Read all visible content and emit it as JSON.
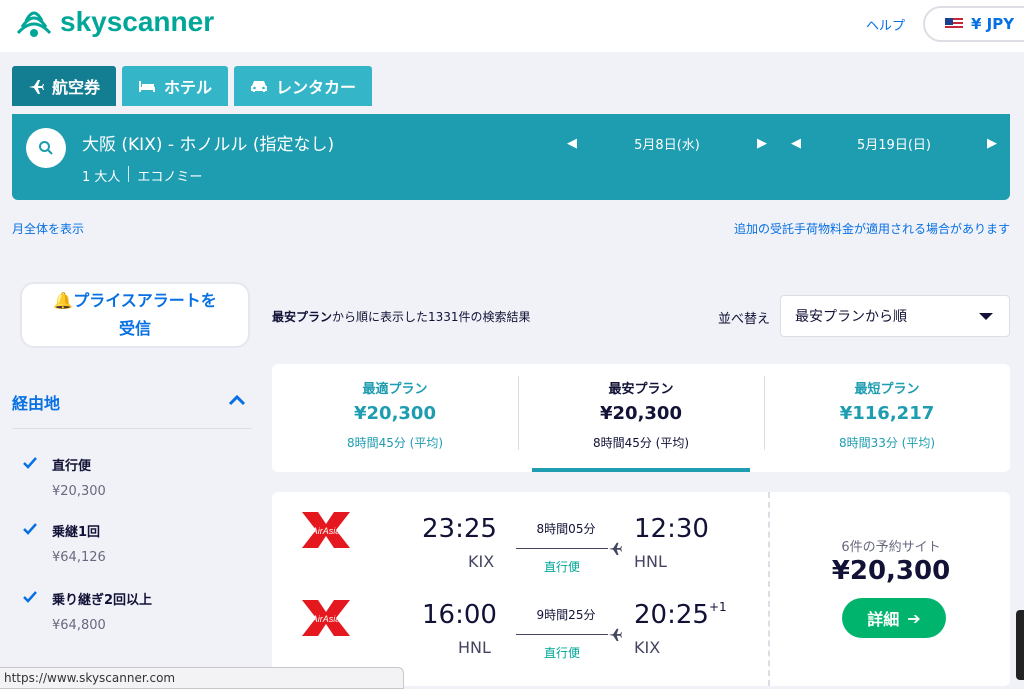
{
  "header": {
    "logo_text": "skyscanner",
    "help": "ヘルプ",
    "currency": "¥ JPY"
  },
  "tabs": [
    {
      "label": "航空券",
      "icon": "plane-icon"
    },
    {
      "label": "ホテル",
      "icon": "bed-icon"
    },
    {
      "label": "レンタカー",
      "icon": "car-icon"
    }
  ],
  "search": {
    "route": "大阪 (KIX) - ホノルル (指定なし)",
    "passengers": "1 大人",
    "cabin": "エコノミー",
    "depart_date": "5月8日(水)",
    "return_date": "5月19日(日)"
  },
  "links": {
    "month_view": "月全体を表示",
    "baggage_note": "追加の受託手荷物料金が適用される場合があります"
  },
  "sidebar": {
    "price_alert_line1": "プライスアラートを",
    "price_alert_line2": "受信",
    "stops_title": "経由地",
    "filters": [
      {
        "name": "直行便",
        "price": "¥20,300",
        "checked": true
      },
      {
        "name": "乗継1回",
        "price": "¥64,126",
        "checked": true
      },
      {
        "name": "乗り継ぎ2回以上",
        "price": "¥64,800",
        "checked": true
      }
    ]
  },
  "results": {
    "count_bold": "最安プラン",
    "count_rest": "から順に表示した1331件の検索結果",
    "sort_label": "並べ替え",
    "sort_value": "最安プランから順"
  },
  "summary": [
    {
      "label": "最適プラン",
      "price": "¥20,300",
      "duration": "8時間45分 (平均)"
    },
    {
      "label": "最安プラン",
      "price": "¥20,300",
      "duration": "8時間45分 (平均)"
    },
    {
      "label": "最短プラン",
      "price": "¥116,217",
      "duration": "8時間33分 (平均)"
    }
  ],
  "itinerary": {
    "outbound": {
      "dep_time": "23:25",
      "dep_code": "KIX",
      "duration": "8時間05分",
      "stops": "直行便",
      "arr_time": "12:30",
      "arr_code": "HNL",
      "day_offset": ""
    },
    "inbound": {
      "dep_time": "16:00",
      "dep_code": "HNL",
      "duration": "9時間25分",
      "stops": "直行便",
      "arr_time": "20:25",
      "arr_code": "KIX",
      "day_offset": "+1"
    },
    "sites": "6件の予約サイト",
    "price": "¥20,300",
    "detail_button": "詳細"
  },
  "status_url": "https://www.skyscanner.com",
  "colors": {
    "brand_teal": "#1e9cb0",
    "link_blue": "#0770e3",
    "cta_green": "#00b46e"
  }
}
